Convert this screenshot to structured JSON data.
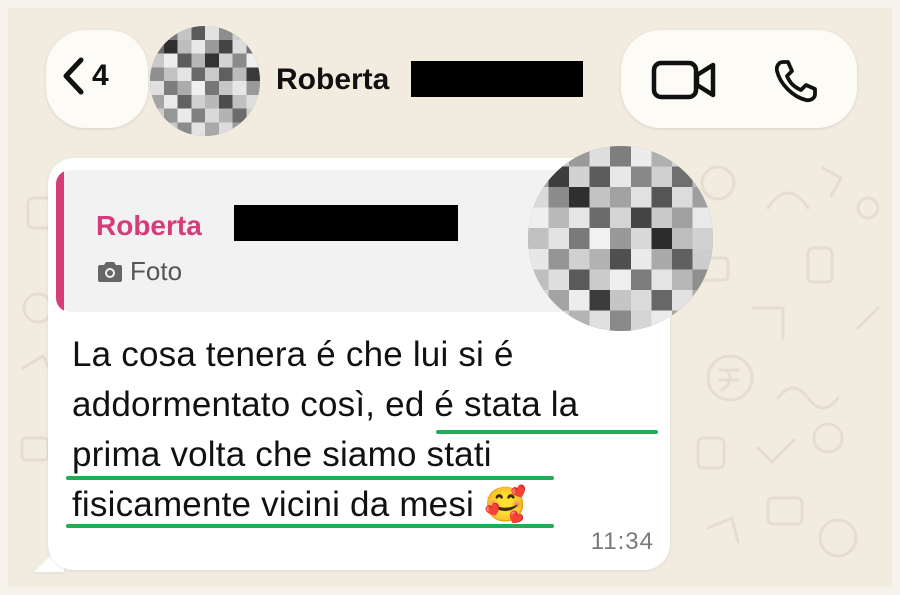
{
  "header": {
    "unread_count": "4",
    "contact_name": "Roberta"
  },
  "quote": {
    "author": "Roberta",
    "media_label": "Foto"
  },
  "message": {
    "text_part1": "La cosa tenera é che lui si é addormentato così, ",
    "text_part2": "ed é stata la prima volta che siamo stati fisicamente vicini da mesi",
    "emoji": "🥰",
    "time": "11:34"
  },
  "colors": {
    "accent_name": "#d63b7a",
    "underline": "#1fae57"
  },
  "icons": [
    "chevron-left-icon",
    "video-call-icon",
    "phone-icon",
    "camera-icon"
  ]
}
